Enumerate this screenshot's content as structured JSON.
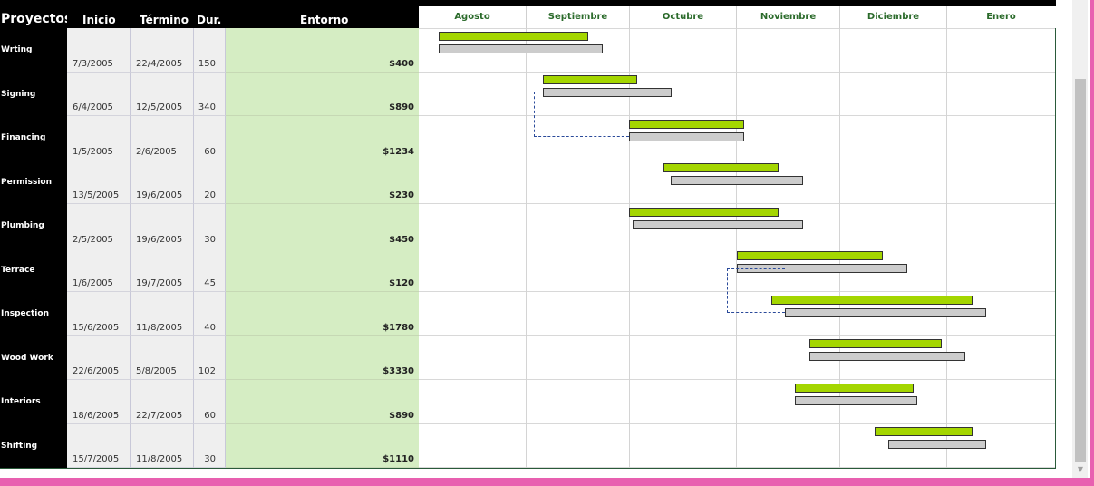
{
  "headers": {
    "project": "Proyectos",
    "start": "Inicio",
    "end": "Término",
    "duration": "Dur.",
    "cost": "Entorno"
  },
  "months": [
    "Agosto",
    "Septiembre",
    "Octubre",
    "Noviembre",
    "Diciembre",
    "Enero"
  ],
  "rows": [
    {
      "name": "Wrting",
      "start": "7/3/2005",
      "end": "22/4/2005",
      "dur": "150",
      "cost": "$400"
    },
    {
      "name": "Signing",
      "start": "6/4/2005",
      "end": "12/5/2005",
      "dur": "340",
      "cost": "$890"
    },
    {
      "name": "Financing",
      "start": "1/5/2005",
      "end": "2/6/2005",
      "dur": "60",
      "cost": "$1234"
    },
    {
      "name": "Permission",
      "start": "13/5/2005",
      "end": "19/6/2005",
      "dur": "20",
      "cost": "$230"
    },
    {
      "name": "Plumbing",
      "start": "2/5/2005",
      "end": "19/6/2005",
      "dur": "30",
      "cost": "$450"
    },
    {
      "name": "Terrace",
      "start": "1/6/2005",
      "end": "19/7/2005",
      "dur": "45",
      "cost": "$120"
    },
    {
      "name": "Inspection",
      "start": "15/6/2005",
      "end": "11/8/2005",
      "dur": "40",
      "cost": "$1780"
    },
    {
      "name": "Wood Work",
      "start": "22/6/2005",
      "end": "5/8/2005",
      "dur": "102",
      "cost": "$3330"
    },
    {
      "name": "Interiors",
      "start": "18/6/2005",
      "end": "22/7/2005",
      "dur": "60",
      "cost": "$890"
    },
    {
      "name": "Shifting",
      "start": "15/7/2005",
      "end": "11/8/2005",
      "dur": "30",
      "cost": "$1110"
    }
  ],
  "colors": {
    "plan_bar": "#a4d600",
    "actual_bar": "#cccccc",
    "cost_column": "#d5edc3",
    "month_text": "#2a6a2a",
    "dependency_line": "#2a4a9a"
  },
  "icons": {
    "scroll_down": "scroll-down-arrow-icon"
  }
}
